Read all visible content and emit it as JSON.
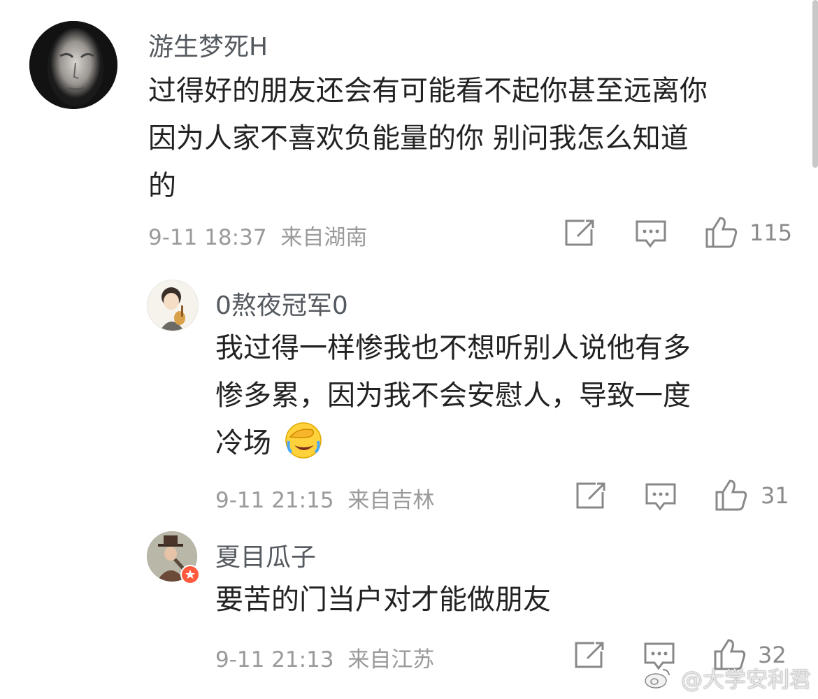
{
  "comments": [
    {
      "username": "游生梦死H",
      "lines": [
        "过得好的朋友还会有可能看不起你甚至远离你",
        "因为人家不喜欢负能量的你 别问我怎么知道",
        "的"
      ],
      "time": "9-11 18:37",
      "location": "来自湖南",
      "likes": "115"
    },
    {
      "username": "0熬夜冠军0",
      "lines": [
        "我过得一样惨我也不想听别人说他有多",
        "惨多累，因为我不会安慰人，导致一度",
        "冷场"
      ],
      "emoji": "facepalm-cry-emoji",
      "time": "9-11 21:15",
      "location": "来自吉林",
      "likes": "31"
    },
    {
      "username": "夏目瓜子",
      "lines": [
        "要苦的门当户对才能做朋友"
      ],
      "time": "9-11 21:13",
      "location": "来自江苏",
      "likes": "32"
    }
  ],
  "watermark": "@大学安利君",
  "colors": {
    "text": "#222222",
    "username": "#555a60",
    "meta": "#9a9a9a",
    "badge": "#ff5a3c"
  }
}
